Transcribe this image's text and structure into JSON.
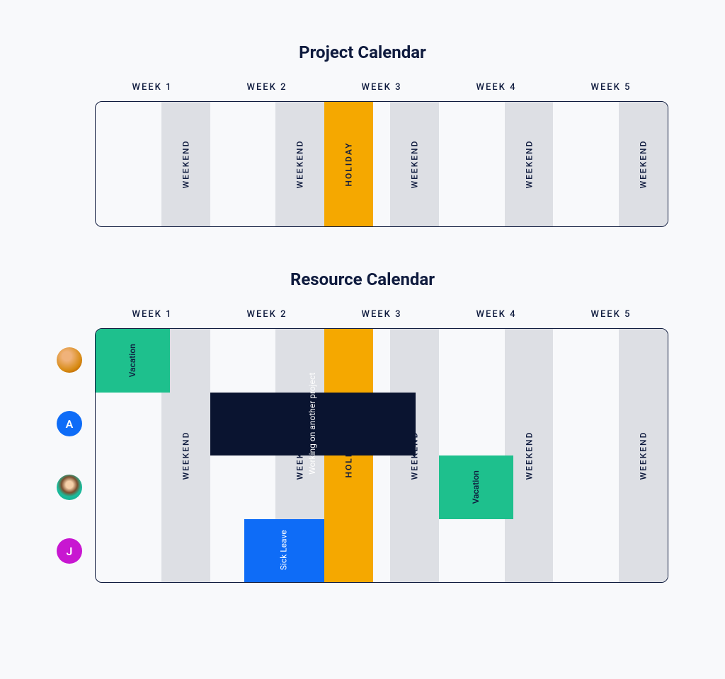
{
  "project": {
    "title": "Project Calendar",
    "weeks": [
      "WEEK 1",
      "WEEK 2",
      "WEEK 3",
      "WEEK 4",
      "WEEK 5"
    ],
    "weekend_label": "WEEKEND",
    "holiday_label": "HOLIDAY"
  },
  "resource": {
    "title": "Resource Calendar",
    "weeks": [
      "WEEK 1",
      "WEEK 2",
      "WEEK 3",
      "WEEK 4",
      "WEEK 5"
    ],
    "weekend_label": "WEEKEND",
    "holiday_label": "HOLIDAY",
    "people": [
      {
        "label": "",
        "type": "photo1"
      },
      {
        "label": "A",
        "type": "letter-a"
      },
      {
        "label": "",
        "type": "photo2"
      },
      {
        "label": "J",
        "type": "letter-j"
      }
    ],
    "bars": {
      "vacation1": "Vacation",
      "working": "Working\non another\nproject",
      "vacation2": "Vacation",
      "sick": "Sick Leave"
    }
  }
}
